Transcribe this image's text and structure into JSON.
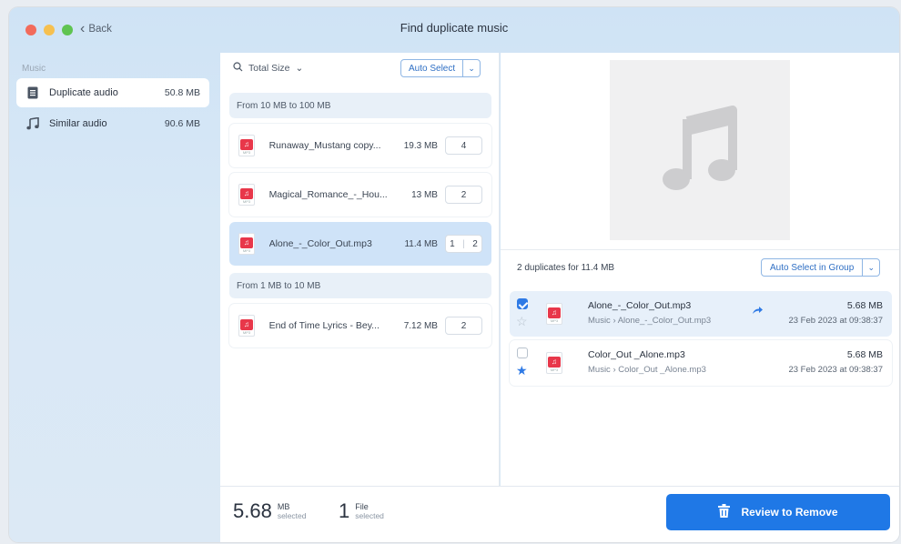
{
  "window": {
    "title": "Find duplicate music",
    "back_label": "Back"
  },
  "sidebar": {
    "section": "Music",
    "items": [
      {
        "label": "Duplicate audio",
        "size": "50.8 MB",
        "icon": "document-icon"
      },
      {
        "label": "Similar audio",
        "size": "90.6 MB",
        "icon": "music-note-icon"
      }
    ],
    "logo": "nektony"
  },
  "middle": {
    "sort_label": "Total Size",
    "auto_select_label": "Auto Select",
    "groups": [
      {
        "header": "From 10 MB to 100 MB"
      },
      {
        "header": "From 1 MB to 10 MB"
      }
    ],
    "files": [
      {
        "name": "Runaway_Mustang copy...",
        "size": "19.3 MB",
        "count": "4"
      },
      {
        "name": "Magical_Romance_-_Hou...",
        "size": "13 MB",
        "count": "2"
      },
      {
        "name": "Alone_-_Color_Out.mp3",
        "size": "11.4 MB",
        "count_selected": "1",
        "count": "2"
      },
      {
        "name": "End of Time Lyrics - Bey...",
        "size": "7.12 MB",
        "count": "2"
      }
    ]
  },
  "details": {
    "dup_header": "2 duplicates for 11.4 MB",
    "auto_select_group_label": "Auto Select in Group",
    "rows": [
      {
        "name": "Alone_-_Color_Out.mp3",
        "path": "Music › Alone_-_Color_Out.mp3",
        "size": "5.68 MB",
        "date": "23 Feb 2023 at 09:38:37",
        "checked": true,
        "starred": false
      },
      {
        "name": "Color_Out _Alone.mp3",
        "path": "Music › Color_Out _Alone.mp3",
        "size": "5.68 MB",
        "date": "23 Feb 2023 at 09:38:37",
        "checked": false,
        "starred": true
      }
    ]
  },
  "footer": {
    "selected_size": "5.68",
    "size_unit": "MB",
    "size_caption": "selected",
    "selected_count": "1",
    "count_unit": "File",
    "count_caption": "selected",
    "review_button": "Review to Remove"
  },
  "colors": {
    "accent": "#1f78e6",
    "mp3_badge": "#e8374a",
    "selected_row": "#cfe3f8"
  }
}
